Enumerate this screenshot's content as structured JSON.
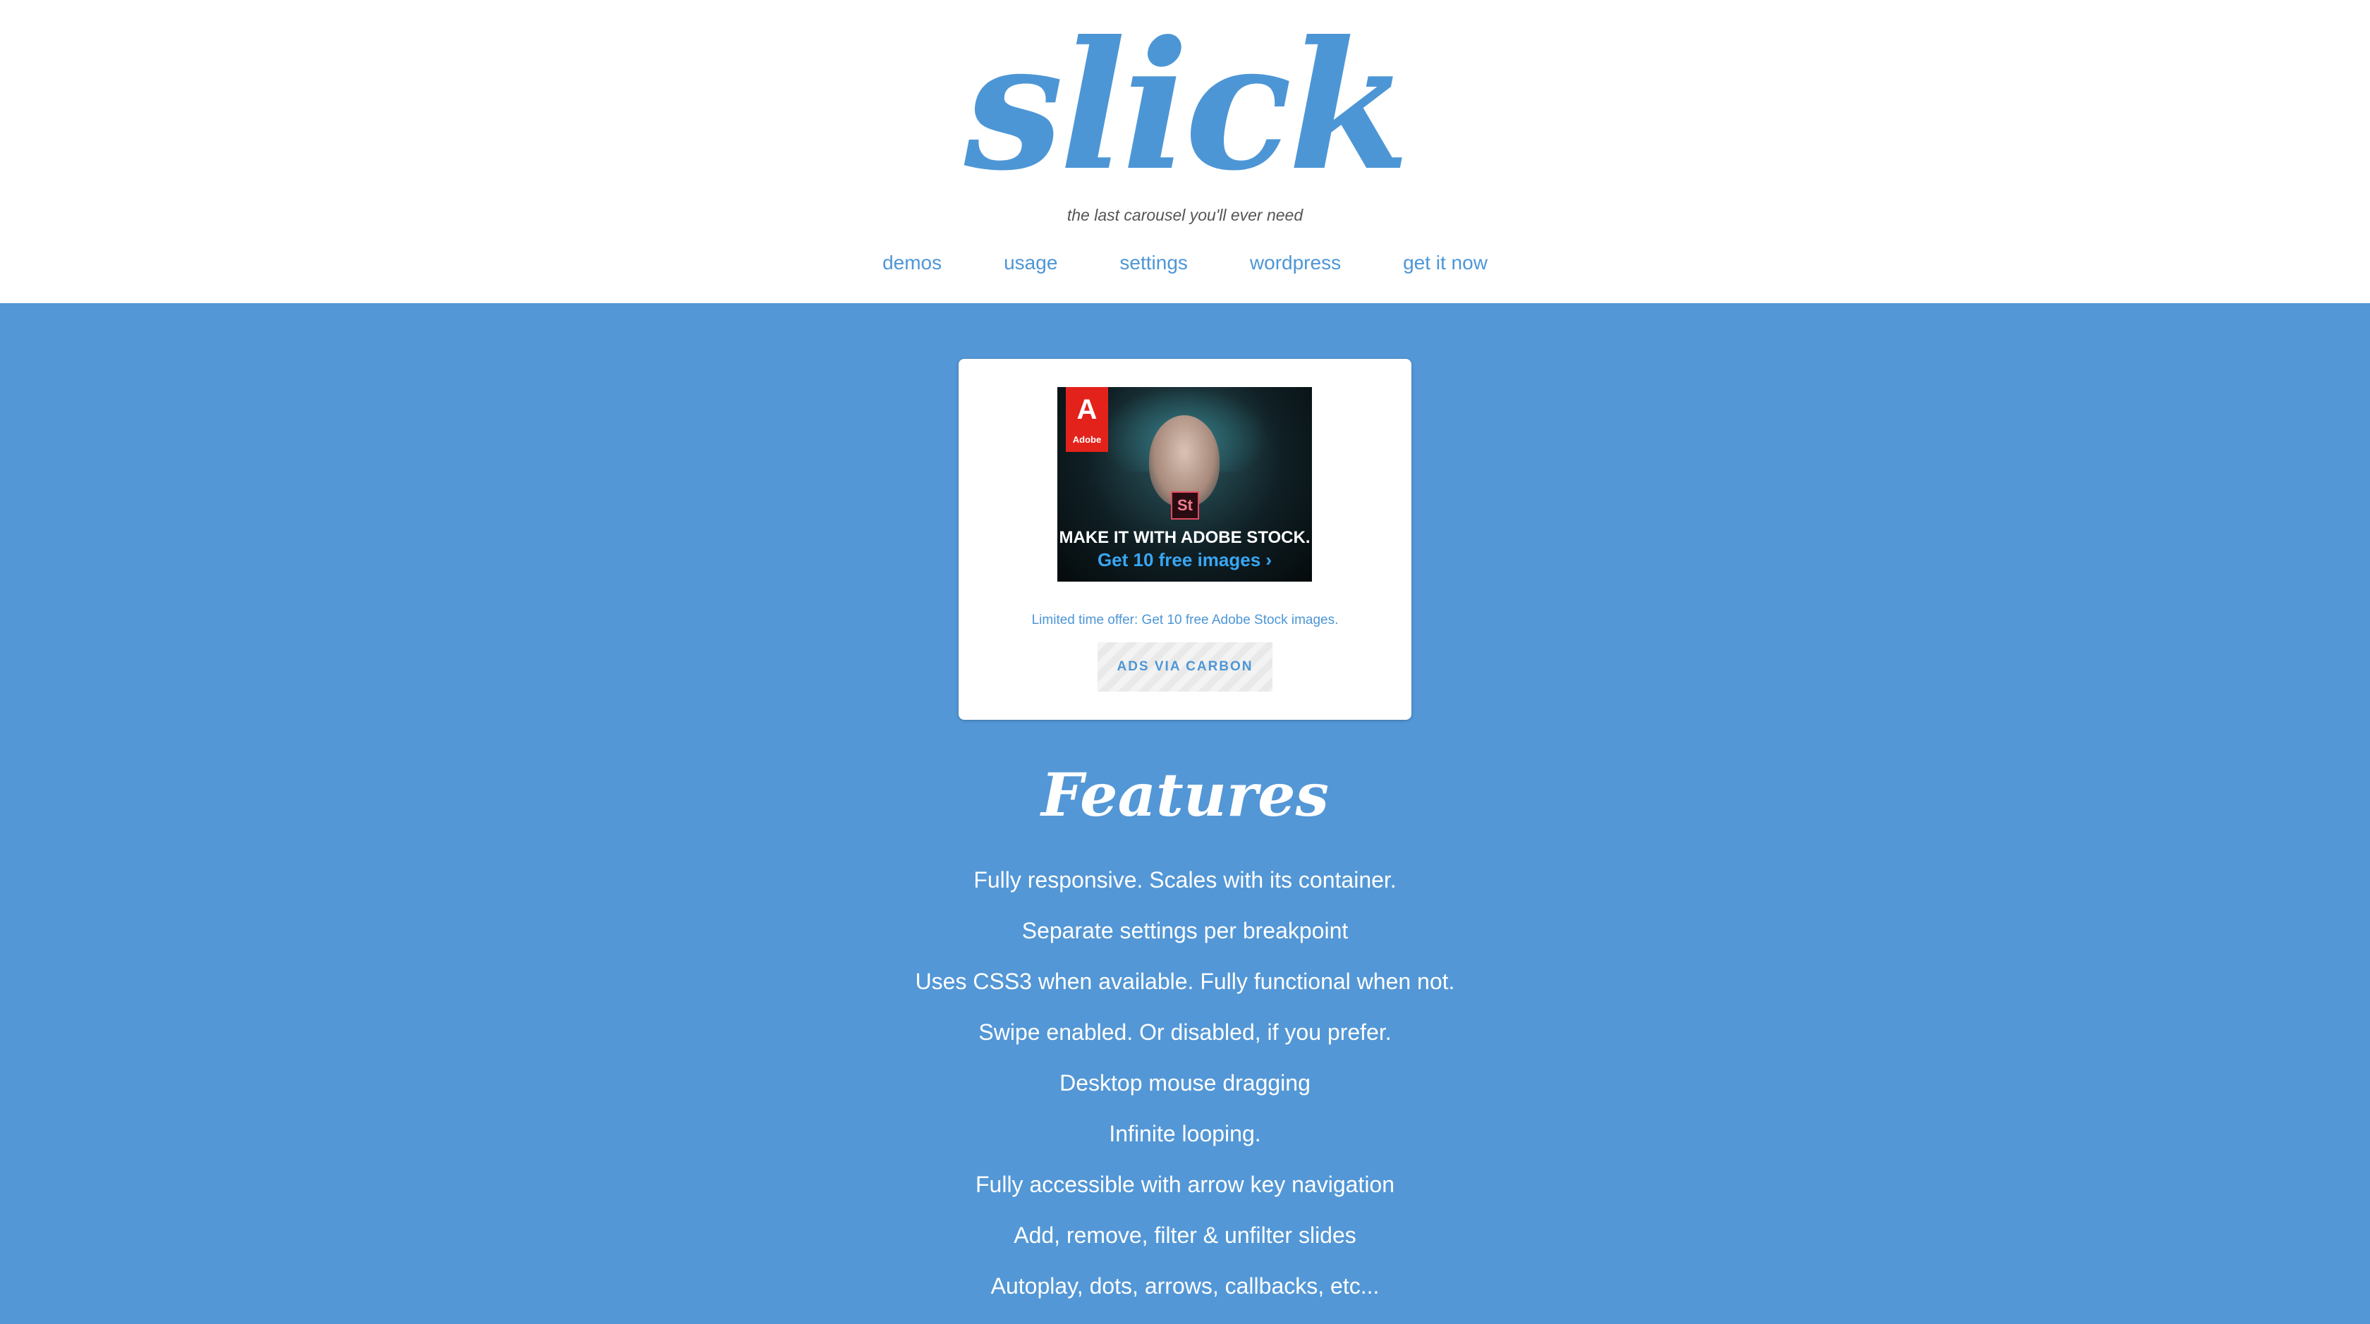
{
  "header": {
    "logo": "slick",
    "tagline": "the last carousel you'll ever need",
    "nav": [
      {
        "label": "demos"
      },
      {
        "label": "usage"
      },
      {
        "label": "settings"
      },
      {
        "label": "wordpress"
      },
      {
        "label": "get it now"
      }
    ]
  },
  "ad": {
    "brand_logo_text": "Adobe",
    "badge": "St",
    "headline": "MAKE IT WITH ADOBE STOCK.",
    "subline": "Get 10 free images ›",
    "description": "Limited time offer: Get 10 free Adobe Stock images.",
    "carbon_label": "ADS VIA CARBON"
  },
  "features": {
    "title": "Features",
    "items": [
      "Fully responsive. Scales with its container.",
      "Separate settings per breakpoint",
      "Uses CSS3 when available. Fully functional when not.",
      "Swipe enabled. Or disabled, if you prefer.",
      "Desktop mouse dragging",
      "Infinite looping.",
      "Fully accessible with arrow key navigation",
      "Add, remove, filter & unfilter slides",
      "Autoplay, dots, arrows, callbacks, etc..."
    ]
  },
  "colors": {
    "brand": "#4d96d6",
    "background": "#5397d6",
    "header_bg": "#ffffff"
  }
}
